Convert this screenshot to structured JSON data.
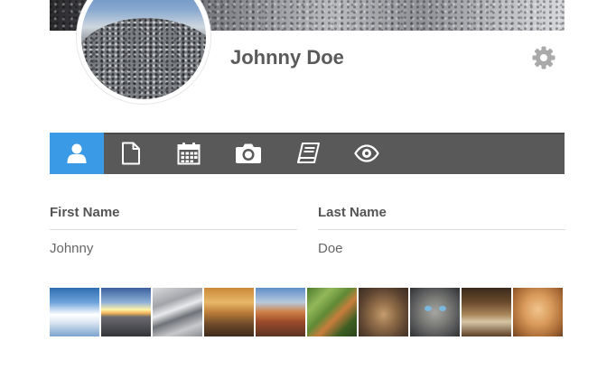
{
  "profile": {
    "name": "Johnny Doe",
    "settings_icon": "gear-icon"
  },
  "tabs": [
    {
      "icon": "user-icon",
      "active": true
    },
    {
      "icon": "file-icon",
      "active": false
    },
    {
      "icon": "calendar-icon",
      "active": false
    },
    {
      "icon": "camera-icon",
      "active": false
    },
    {
      "icon": "book-icon",
      "active": false
    },
    {
      "icon": "eye-icon",
      "active": false
    }
  ],
  "form": {
    "first_name": {
      "label": "First Name",
      "value": "Johnny"
    },
    "last_name": {
      "label": "Last Name",
      "value": "Doe"
    }
  },
  "gallery": {
    "items": [
      "clouds-photo",
      "sunset-road-photo",
      "snowy-rocks-photo",
      "desert-car-photo",
      "canyon-photo",
      "cat-in-tree-photo",
      "sitting-cat-photo",
      "blue-eyed-cat-photo",
      "cat-in-suitcase-photo",
      "orange-kitten-photo"
    ]
  },
  "colors": {
    "accent": "#3a9ae6",
    "tabbar": "#595959",
    "name_text": "#5a5a5a",
    "icon_gray": "#a9a9a9"
  }
}
